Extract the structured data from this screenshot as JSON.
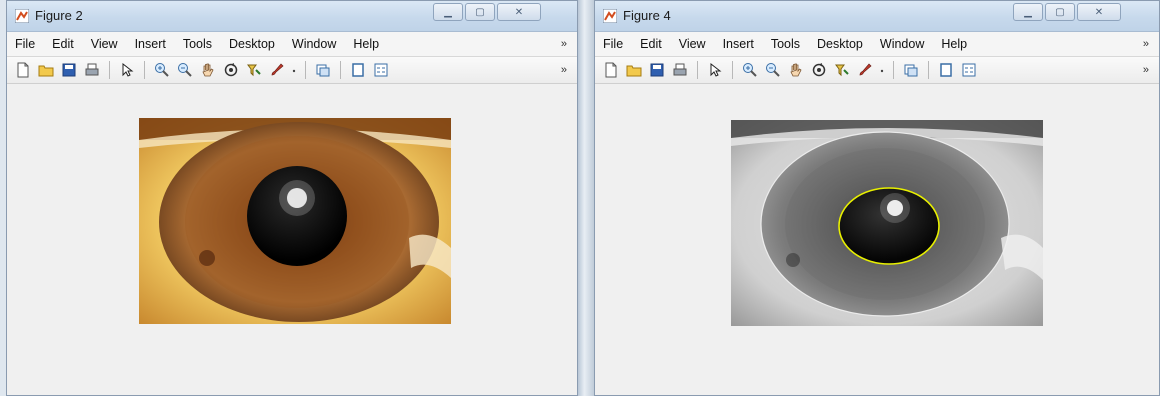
{
  "windows": [
    {
      "title": "Figure 2",
      "menu": [
        "File",
        "Edit",
        "View",
        "Insert",
        "Tools",
        "Desktop",
        "Window",
        "Help"
      ],
      "menu_more": "»",
      "toolbar_more": "»"
    },
    {
      "title": "Figure 4",
      "menu": [
        "File",
        "Edit",
        "View",
        "Insert",
        "Tools",
        "Desktop",
        "Window",
        "Help"
      ],
      "menu_more": "»",
      "toolbar_more": "»"
    }
  ],
  "toolbar_icons": [
    "new-file-icon",
    "open-folder-icon",
    "save-icon",
    "print-icon",
    "pointer-icon",
    "zoom-in-icon",
    "zoom-out-icon",
    "pan-hand-icon",
    "rotate-3d-icon",
    "data-cursor-icon",
    "brush-icon",
    "link-icon",
    "colorbar-icon",
    "legend-icon"
  ],
  "colors": {
    "iris_brown": "#8a4a1a",
    "sclera_yellow": "#f3d278",
    "boundary_circle": "#e8f000"
  }
}
